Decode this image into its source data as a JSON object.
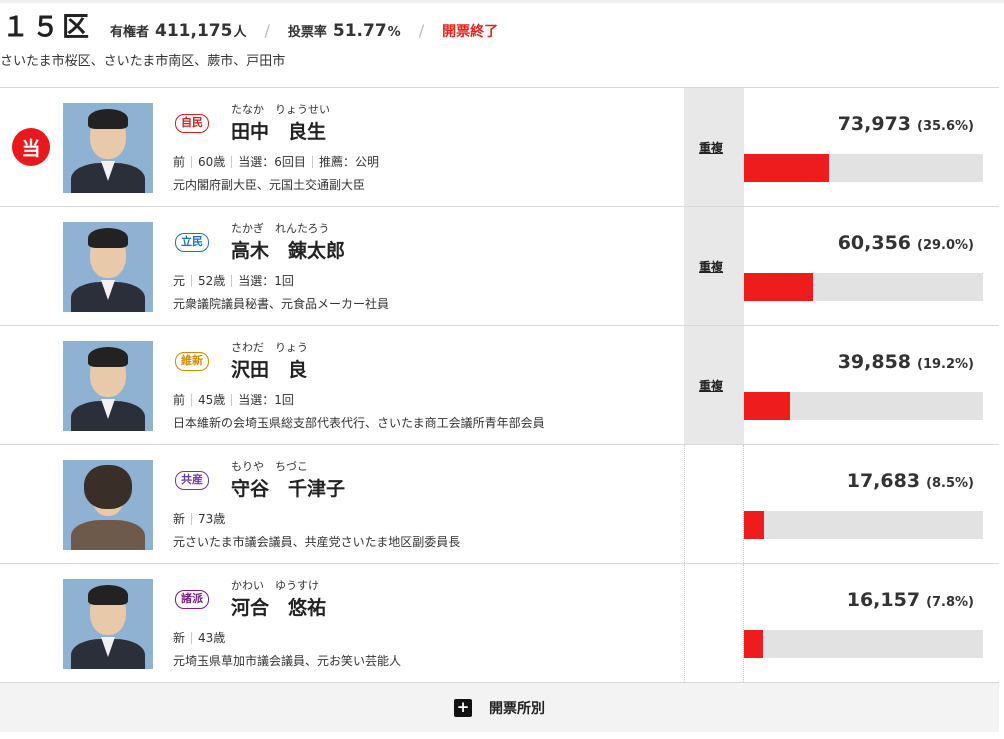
{
  "header": {
    "district": "１５区",
    "electorate_label": "有権者",
    "electorate_value": "411,175",
    "electorate_unit": "人",
    "turnout_label": "投票率",
    "turnout_value": "51.77",
    "turnout_unit": "%",
    "separator": "/",
    "status": "開票終了"
  },
  "areas": "さいたま市桜区、さいたま市南区、蕨市、戸田市",
  "candidates": [
    {
      "elected": true,
      "elected_mark": "当",
      "party": "自民",
      "party_color": "#d0201a",
      "kana": "たなか　りょうせい",
      "name": "田中　良生",
      "info": [
        "前",
        "60歳",
        "当選：6回目",
        "推薦：公明"
      ],
      "career": "元内閣府副大臣、元国土交通副大臣",
      "duplicate": "重複",
      "votes": "73,973",
      "percent": "(35.6%)",
      "share": 35.6
    },
    {
      "elected": false,
      "party": "立民",
      "party_color": "#1f6fc6",
      "kana": "たかぎ　れんたろう",
      "name": "高木　錬太郎",
      "info": [
        "元",
        "52歳",
        "当選：1回"
      ],
      "career": "元衆議院議員秘書、元食品メーカー社員",
      "duplicate": "重複",
      "votes": "60,356",
      "percent": "(29.0%)",
      "share": 29.0
    },
    {
      "elected": false,
      "party": "維新",
      "party_color": "#d68a00",
      "kana": "さわだ　りょう",
      "name": "沢田　良",
      "info": [
        "前",
        "45歳",
        "当選：1回"
      ],
      "career": "日本維新の会埼玉県総支部代表代行、さいたま商工会議所青年部会員",
      "duplicate": "重複",
      "votes": "39,858",
      "percent": "(19.2%)",
      "share": 19.2
    },
    {
      "elected": false,
      "party": "共産",
      "party_color": "#6a3aa8",
      "kana": "もりや　ちづこ",
      "name": "守谷　千津子",
      "info": [
        "新",
        "73歳"
      ],
      "career": "元さいたま市議会議員、共産党さいたま地区副委員長",
      "duplicate": "",
      "votes": "17,683",
      "percent": "(8.5%)",
      "share": 8.5
    },
    {
      "elected": false,
      "party": "諸派",
      "party_color": "#7a1c78",
      "kana": "かわい　ゆうすけ",
      "name": "河合　悠祐",
      "info": [
        "新",
        "43歳"
      ],
      "career": "元埼玉県草加市議会議員、元お笑い芸能人",
      "duplicate": "",
      "votes": "16,157",
      "percent": "(7.8%)",
      "share": 7.8
    }
  ],
  "footer": {
    "icon": "plus-icon",
    "label": "開票所別"
  },
  "bar_scale_max": 100
}
